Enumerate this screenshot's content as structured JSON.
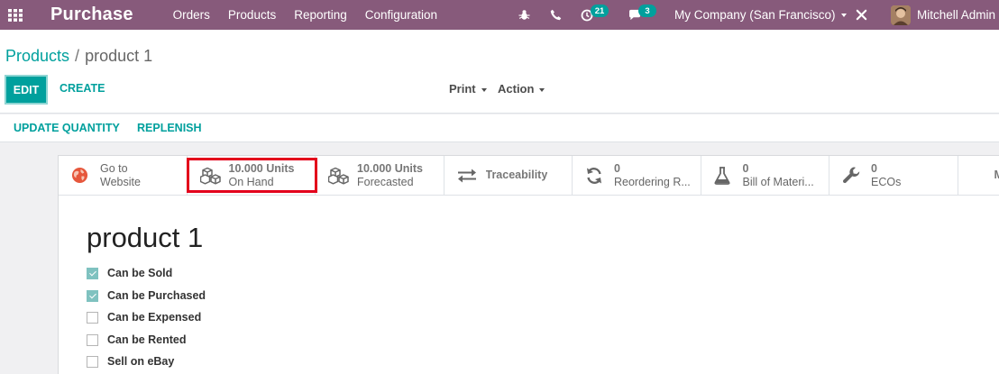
{
  "navbar": {
    "app_title": "Purchase",
    "menu": [
      "Orders",
      "Products",
      "Reporting",
      "Configuration"
    ],
    "activity_count": "21",
    "message_count": "3",
    "company": "My Company (San Francisco)",
    "user": "Mitchell Admin",
    "brand_color": "#875a7b",
    "accent_color": "#00a09d"
  },
  "breadcrumb": {
    "parent": "Products",
    "separator": "/",
    "current": "product 1"
  },
  "actions": {
    "edit": "EDIT",
    "create": "CREATE",
    "print": "Print",
    "action": "Action"
  },
  "statusbar": {
    "update_quantity": "UPDATE QUANTITY",
    "replenish": "REPLENISH"
  },
  "smart_buttons": [
    {
      "icon": "globe-icon",
      "value": "Go to",
      "label": "Website"
    },
    {
      "icon": "cubes-icon",
      "value": "10.000 Units",
      "label": "On Hand"
    },
    {
      "icon": "cubes-icon",
      "value": "10.000 Units",
      "label": "Forecasted"
    },
    {
      "icon": "arrows-exchange-icon",
      "label": "Traceability"
    },
    {
      "icon": "refresh-icon",
      "value": "0",
      "label": "Reordering R..."
    },
    {
      "icon": "flask-icon",
      "value": "0",
      "label": "Bill of Materi..."
    },
    {
      "icon": "wrench-icon",
      "value": "0",
      "label": "ECOs"
    },
    {
      "icon": "more-icon",
      "label": "M"
    }
  ],
  "product": {
    "name": "product 1",
    "options": [
      {
        "label": "Can be Sold",
        "checked": true
      },
      {
        "label": "Can be Purchased",
        "checked": true
      },
      {
        "label": "Can be Expensed",
        "checked": false
      },
      {
        "label": "Can be Rented",
        "checked": false
      },
      {
        "label": "Sell on eBay",
        "checked": false
      }
    ]
  }
}
